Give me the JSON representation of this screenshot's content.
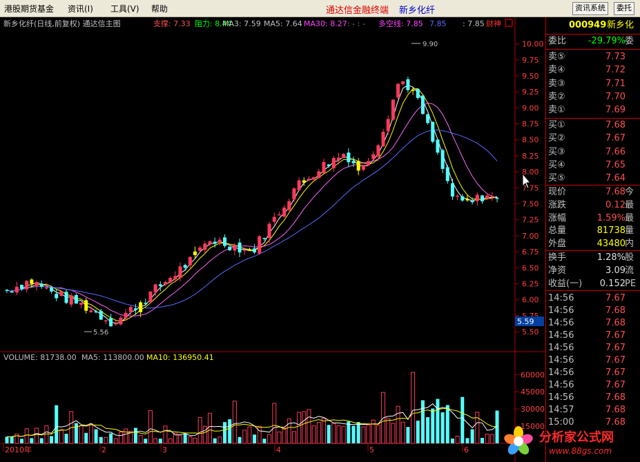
{
  "menubar": {
    "items": [
      "港股期货基金",
      "资讯(I)",
      "工具(V)",
      "帮助"
    ],
    "center_title": "通达信金融终端",
    "stock_title": "新乡化纤",
    "btn1": "资讯系统",
    "btn2": "委托"
  },
  "header": {
    "name": "新乡化纤(日线,前复权) 通达信主图",
    "support": "支撑: 7.33",
    "resistance": "阻力: 8.44",
    "ma3": "MA3: 7.59",
    "ma5": "MA5: 7.64",
    "ma30": "MA30: 8.27",
    "dashes": ": - : -",
    "dkx": "多空线: 7.85",
    "dkx2": "7.85",
    "last": ": 7.85",
    "fin": "财神"
  },
  "vol_header": {
    "vol": "VOLUME: 81738.00",
    "ma5": "MA5: 113800.00",
    "ma10": "MA10: 136950.41"
  },
  "labels": {
    "high": "9.90",
    "low": "5.56",
    "cursor_price": "5.59"
  },
  "chart_data": {
    "type": "candlestick",
    "y_ticks": [
      "10.00",
      "9.75",
      "9.50",
      "9.25",
      "9.00",
      "8.75",
      "8.50",
      "8.25",
      "8.00",
      "7.75",
      "7.50",
      "7.25",
      "7.00",
      "6.75",
      "6.50",
      "6.25",
      "6.00",
      "5.75",
      "5.50"
    ],
    "ylim": [
      5.35,
      10.2
    ],
    "vol_ticks": [
      "60000",
      "45000",
      "30000",
      "15000"
    ],
    "vol_ylim": [
      0,
      68000
    ],
    "x_labels": [
      "2010年",
      "2",
      "3",
      "4",
      "5",
      "6"
    ],
    "colors": {
      "up": "#ff3a5c",
      "down": "#54ffff",
      "ma_white": "#ffffff",
      "ma_yellow": "#ffff00",
      "ma_pink": "#ff66ff",
      "ma_blue": "#5a6cff",
      "ma_green": "#00ff00",
      "signal_yellow": "#ffff00",
      "signal_green": "#22cc22"
    }
  },
  "quote": {
    "code": "000949",
    "name": "新乡化",
    "webi_label": "委比",
    "webi": "-29.79%",
    "webi_x": "委",
    "asks": [
      {
        "label": "卖⑤",
        "price": "7.73"
      },
      {
        "label": "卖④",
        "price": "7.72"
      },
      {
        "label": "卖③",
        "price": "7.71"
      },
      {
        "label": "卖②",
        "price": "7.70"
      },
      {
        "label": "卖①",
        "price": "7.69"
      }
    ],
    "bids": [
      {
        "label": "买①",
        "price": "7.68"
      },
      {
        "label": "买②",
        "price": "7.67"
      },
      {
        "label": "买③",
        "price": "7.66"
      },
      {
        "label": "买④",
        "price": "7.65"
      },
      {
        "label": "买⑤",
        "price": "7.64"
      }
    ],
    "stats": [
      {
        "label": "现价",
        "value": "7.68",
        "x": "今"
      },
      {
        "label": "涨跌",
        "value": "0.12",
        "x": "最"
      },
      {
        "label": "涨幅",
        "value": "1.59%",
        "x": "最"
      },
      {
        "label": "总量",
        "value": "81738",
        "x": "量"
      },
      {
        "label": "外盘",
        "value": "43480",
        "x": "内"
      }
    ],
    "stats2": [
      {
        "label": "换手",
        "value": "1.28%",
        "x": "股"
      },
      {
        "label": "净资",
        "value": "3.09",
        "x": "流"
      },
      {
        "label": "收益(一)",
        "value": "0.152",
        "x": "PE"
      }
    ],
    "ticks": [
      {
        "time": "14:56",
        "price": "7.67"
      },
      {
        "time": "14:56",
        "price": "7.68"
      },
      {
        "time": "14:56",
        "price": "7.68"
      },
      {
        "time": "14:56",
        "price": "7.67"
      },
      {
        "time": "14:56",
        "price": "7.67"
      },
      {
        "time": "14:56",
        "price": "7.67"
      },
      {
        "time": "14:56",
        "price": "7.67"
      },
      {
        "time": "14:56",
        "price": "7.67"
      },
      {
        "time": "14:56",
        "price": "7.68"
      },
      {
        "time": "14:57",
        "price": "7.68"
      },
      {
        "time": "15:00",
        "price": "7.68"
      }
    ]
  },
  "watermark": {
    "title": "分析家公式网",
    "url": "www.88gs.com"
  }
}
